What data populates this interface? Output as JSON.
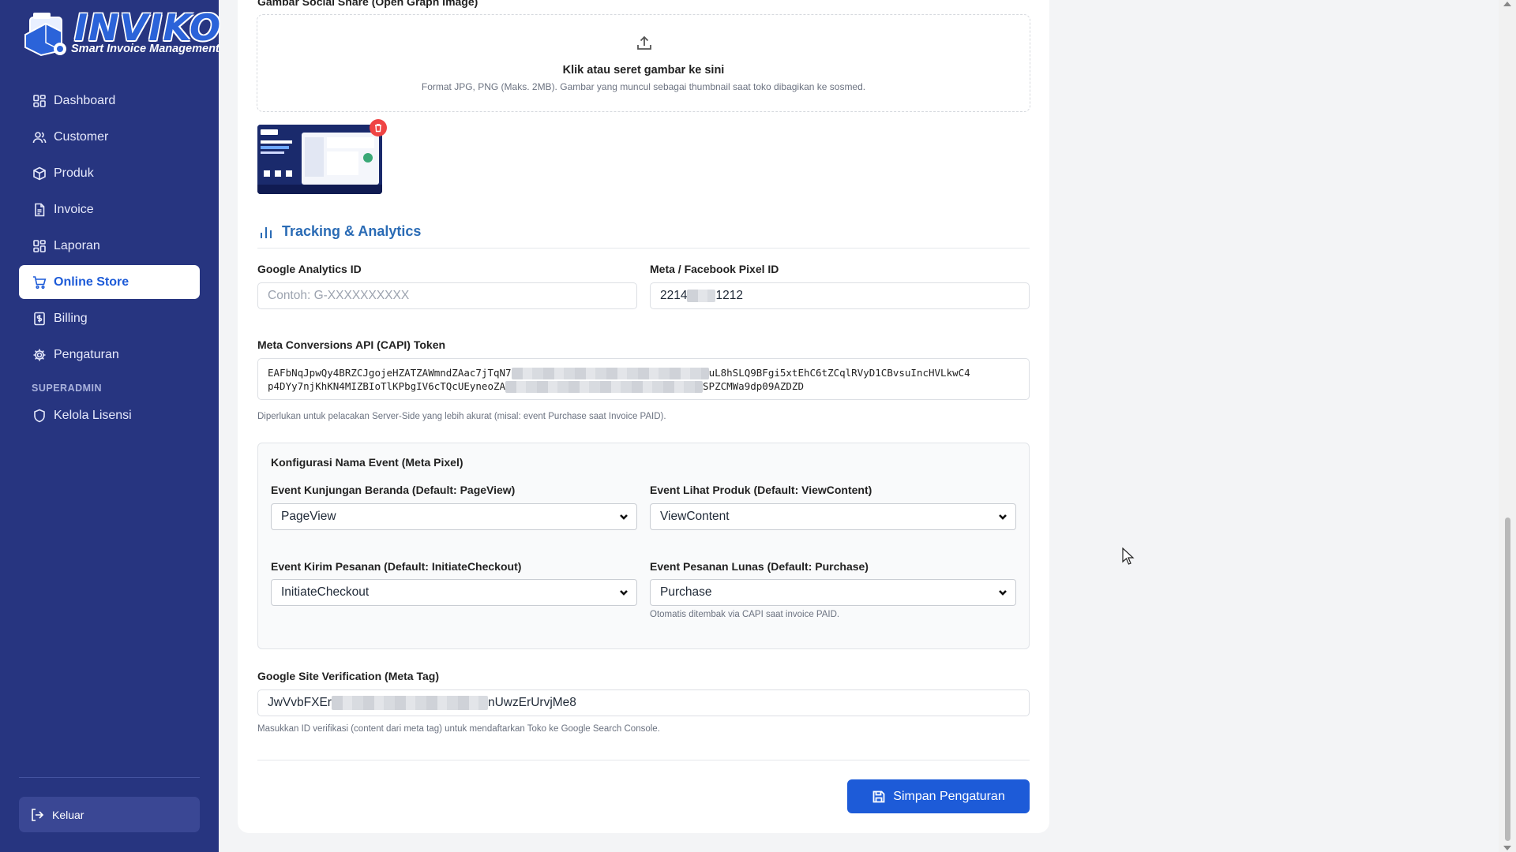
{
  "brand": {
    "name": "INVIKO",
    "tagline": "Smart Invoice Management",
    "logo_icon": "truck-box-logo"
  },
  "sidebar": {
    "items": [
      {
        "label": "Dashboard",
        "icon": "grid-icon"
      },
      {
        "label": "Customer",
        "icon": "users-icon"
      },
      {
        "label": "Produk",
        "icon": "box-icon"
      },
      {
        "label": "Invoice",
        "icon": "file-icon"
      },
      {
        "label": "Laporan",
        "icon": "grid-icon"
      },
      {
        "label": "Online Store",
        "icon": "cart-icon",
        "active": true
      },
      {
        "label": "Billing",
        "icon": "receipt-icon"
      },
      {
        "label": "Pengaturan",
        "icon": "gear-icon"
      }
    ],
    "section_label": "SUPERADMIN",
    "admin_items": [
      {
        "label": "Kelola Lisensi",
        "icon": "shield-icon"
      }
    ],
    "logout_label": "Keluar"
  },
  "upload": {
    "section_label": "Gambar Social Share (Open Graph Image)",
    "title": "Klik atau seret gambar ke sini",
    "subtitle": "Format JPG, PNG (Maks. 2MB). Gambar yang muncul sebagai thumbnail saat toko dibagikan ke sosmed."
  },
  "tracking": {
    "title": "Tracking & Analytics",
    "ga_label": "Google Analytics ID",
    "ga_placeholder": "Contoh: G-XXXXXXXXXX",
    "pixel_label": "Meta / Facebook Pixel ID",
    "pixel_value_start": "2214",
    "pixel_value_end": "1212",
    "capi_label": "Meta Conversions API (CAPI) Token",
    "capi_line1_start": "EAFbNqJpwQy4BRZCJgojeHZATZAWmndZAac7jTqN7",
    "capi_line1_end": "uL8hSLQ9BFgi5xtEhC6tZCqlRVyD1CBvsuIncHVLkwC4",
    "capi_line2_start": "p4DYy7njKhKN4MIZBIoTlKPbgIV6cTQcUEyneoZA",
    "capi_line2_end": "SPZCMWa9dp09AZDZD",
    "capi_help": "Diperlukan untuk pelacakan Server-Side yang lebih akurat (misal: event Purchase saat Invoice PAID)."
  },
  "events": {
    "title": "Konfigurasi Nama Event (Meta Pixel)",
    "home_label": "Event Kunjungan Beranda (Default: PageView)",
    "home_value": "PageView",
    "product_label": "Event Lihat Produk (Default: ViewContent)",
    "product_value": "ViewContent",
    "checkout_label": "Event Kirim Pesanan (Default: InitiateCheckout)",
    "checkout_value": "InitiateCheckout",
    "purchase_label": "Event Pesanan Lunas (Default: Purchase)",
    "purchase_value": "Purchase",
    "purchase_help": "Otomatis ditembak via CAPI saat invoice PAID."
  },
  "verification": {
    "label": "Google Site Verification (Meta Tag)",
    "value_start": "JwVvbFXEr",
    "value_end": "nUwzErUrvjMe8",
    "help": "Masukkan ID verifikasi (content dari meta tag) untuk mendaftarkan Toko ke Google Search Console."
  },
  "actions": {
    "save_label": "Simpan Pengaturan"
  },
  "colors": {
    "sidebar": "#273580",
    "accent": "#1d5bd8",
    "section_title": "#2a6bb5",
    "danger": "#ef4444"
  }
}
